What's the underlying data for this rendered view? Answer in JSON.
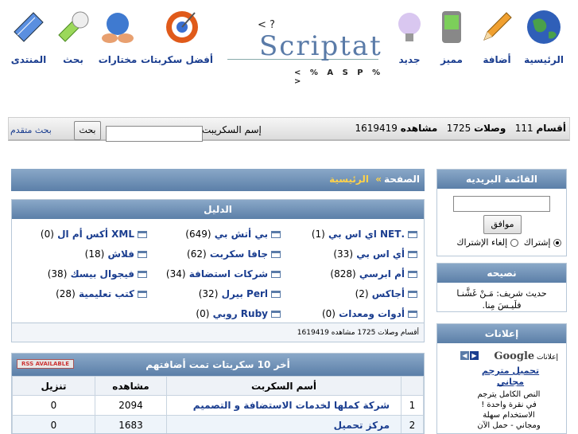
{
  "nav": {
    "home": "الرئيسية",
    "add": "أضافة",
    "featured": "مميز",
    "new": "جديد",
    "best_scripts": "أفضل سكربتات",
    "picks": "مختارات",
    "search": "بحث",
    "forum": "المنتدى"
  },
  "logo": {
    "top": "< ?",
    "word": "Scriptat",
    "tag": "< % A S P % >"
  },
  "stats_bar": {
    "sections_label": "أقسام",
    "sections_value": "111",
    "links_label": "وصلات",
    "links_value": "1725",
    "views_label": "مشاهده",
    "views_value": "1619419",
    "search_label": "إسم السكريبت",
    "search_value": "",
    "search_button": "بحث",
    "advanced_search": "بحث متقدم"
  },
  "breadcrumb": {
    "page": "الصفحة",
    "sep": "»",
    "home": "الرئيسية"
  },
  "directory": {
    "title": "الدليل",
    "items": [
      {
        "name": ".NET اي اس بي",
        "count": "(1)"
      },
      {
        "name": "بي أتش بي",
        "count": "(649)"
      },
      {
        "name": "XML أكس أم ال",
        "count": "(0)"
      },
      {
        "name": "أي اس بي",
        "count": "(33)"
      },
      {
        "name": "جافا سكربت",
        "count": "(62)"
      },
      {
        "name": "فلاش",
        "count": "(18)"
      },
      {
        "name": "أم ابرسي",
        "count": "(828)"
      },
      {
        "name": "شركات استضافة",
        "count": "(34)"
      },
      {
        "name": "فيجوال بيسك",
        "count": "(38)"
      },
      {
        "name": "أجاكس",
        "count": "(2)"
      },
      {
        "name": "Perl بيرل",
        "count": "(32)"
      },
      {
        "name": "كتب تعليمية",
        "count": "(28)"
      },
      {
        "name": "أدوات ومعدات",
        "count": "(0)"
      },
      {
        "name": "Ruby روبي",
        "count": "(0)"
      }
    ],
    "footer": "أقسام   وصلات 1725   مشاهده 1619419"
  },
  "top10": {
    "title": "أخر 10 سكربتات تمت أضافتهم",
    "rss": "RSS AVAILABLE",
    "headers": {
      "name": "أسم السكربت",
      "views": "مشاهده",
      "downloads": "تنزيل"
    },
    "rows": [
      {
        "n": "1",
        "name": "شركة كملها لخدمات الاستضافة و التصميم",
        "views": "2094",
        "downloads": "0"
      },
      {
        "n": "2",
        "name": "مركز تحميل",
        "views": "1683",
        "downloads": "0"
      }
    ]
  },
  "mailing": {
    "title": "القائمة البريديه",
    "input_value": "",
    "ok": "موافق",
    "subscribe": "إشتراك",
    "unsubscribe": "إلغاء الإشتراك"
  },
  "advice": {
    "title": "نصيحه",
    "line1": "حديث شريف: مَـنْ غَشَّنـا",
    "line2": "فلَيـسَ مِنا."
  },
  "ads": {
    "title": "إعلانات",
    "google": "Google",
    "google_label": "إعلانات",
    "link": "تحميل مترجم مجاني",
    "text": "النص الكامل يترجم في نقرة واحدة ! الاستخدام سهلة ومجاني - حمل الآن"
  },
  "colors": {
    "link": "#1a3d8f",
    "header": "#5b7fa8"
  }
}
